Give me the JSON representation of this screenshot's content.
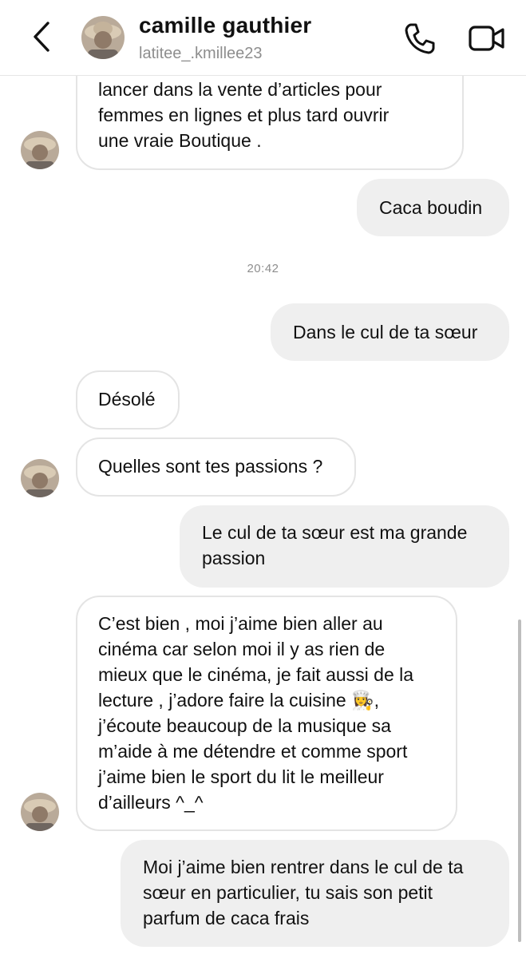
{
  "header": {
    "name": "camille gauthier",
    "username": "latitee_.kmillee23"
  },
  "time_separator": "20:42",
  "messages": [
    {
      "side": "in",
      "lines": [
        "lancer dans la vente d’articles pour",
        "femmes en lignes et plus tard ouvrir",
        "une vraie Boutique ."
      ]
    },
    {
      "side": "out",
      "lines": [
        "Caca boudin"
      ]
    },
    {
      "side": "out",
      "lines": [
        "Dans le cul de ta sœur"
      ]
    },
    {
      "side": "in",
      "lines": [
        "Désolé"
      ]
    },
    {
      "side": "in",
      "lines": [
        "Quelles sont tes passions ?"
      ]
    },
    {
      "side": "out",
      "lines": [
        "Le cul de ta sœur est ma grande",
        "passion"
      ]
    },
    {
      "side": "in",
      "lines": [
        "C’est bien , moi j’aime bien aller au",
        "cinéma car selon moi il y as rien de",
        "mieux que le cinéma, je fait aussi de la",
        "lecture , j’adore faire la cuisine 👩‍🍳,",
        "j’écoute beaucoup de la musique sa",
        "m’aide à me détendre et comme sport",
        "j’aime bien le sport du lit le meilleur",
        "d’ailleurs ^_^"
      ]
    },
    {
      "side": "out",
      "lines": [
        "Moi j’aime bien rentrer dans le cul de ta",
        "sœur en particulier, tu sais son petit",
        "parfum de caca frais"
      ]
    }
  ],
  "icons": {
    "back": "chevron-left-icon",
    "call": "phone-icon",
    "video": "video-camera-icon"
  }
}
